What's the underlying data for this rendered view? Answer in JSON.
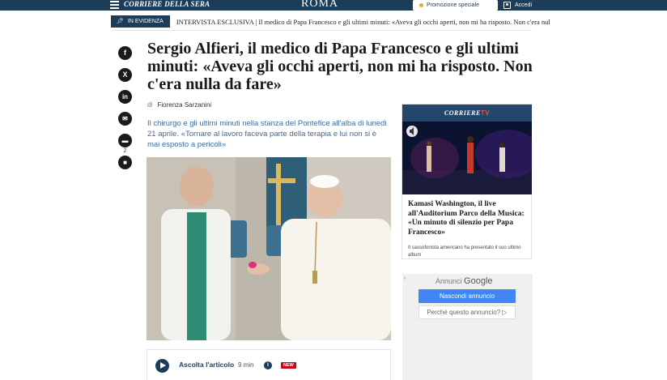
{
  "topbar": {
    "logo": "CORRIERE DELLA SERA",
    "city": "ROMA",
    "promo_label": "Promozione speciale",
    "login_label": "Accedi"
  },
  "evidence": {
    "tag_label": "IN EVIDENZA",
    "ticker": "INTERVISTA ESCLUSIVA | Il medico di Papa Francesco e gli ultimi minuti: «Aveva gli occhi aperti, non mi ha risposto. Non c'era nulla da fare»"
  },
  "share": {
    "items": [
      "facebook-icon",
      "x-icon",
      "linkedin-icon",
      "mail-icon",
      "comment-icon",
      "bookmark-icon"
    ],
    "comment_count": "2"
  },
  "article": {
    "headline": "Sergio Alfieri, il medico di Papa Francesco e gli ultimi minuti: «Aveva gli occhi aperti, non mi ha risposto. Non c'era nulla da fare»",
    "byline_prefix": "di",
    "author": "Fiorenza Sarzanini",
    "summary": "Il chirurgo e gli ultimi minuti nella stanza del Pontefice all'alba di lunedì 21 aprile. «Tornare al lavoro faceva parte della terapia e lui non si è mai esposto a pericoli»"
  },
  "audio": {
    "label": "Ascolta l'articolo",
    "duration": "9 min",
    "info": "i",
    "new_badge": "NEW"
  },
  "tv": {
    "brand": "CORRIERE",
    "brand_tv": "TV",
    "title": "Kamasi Washington, il live all'Auditorium Parco della Musica: «Un minuto di silenzio per Papa Francesco»",
    "description": "Il sassofonista americano ha presentato il suo ultimo album"
  },
  "ad": {
    "back": "‹",
    "annunci": "Annunci",
    "google": "Google",
    "hide_label": "Nascondi annuncio",
    "why_label": "Perché questo annuncio? ▷"
  },
  "colors": {
    "brand_blue": "#1c3d5a",
    "summary_blue": "#3d6b99",
    "new_red": "#d0021b",
    "google_blue": "#4285f4"
  }
}
